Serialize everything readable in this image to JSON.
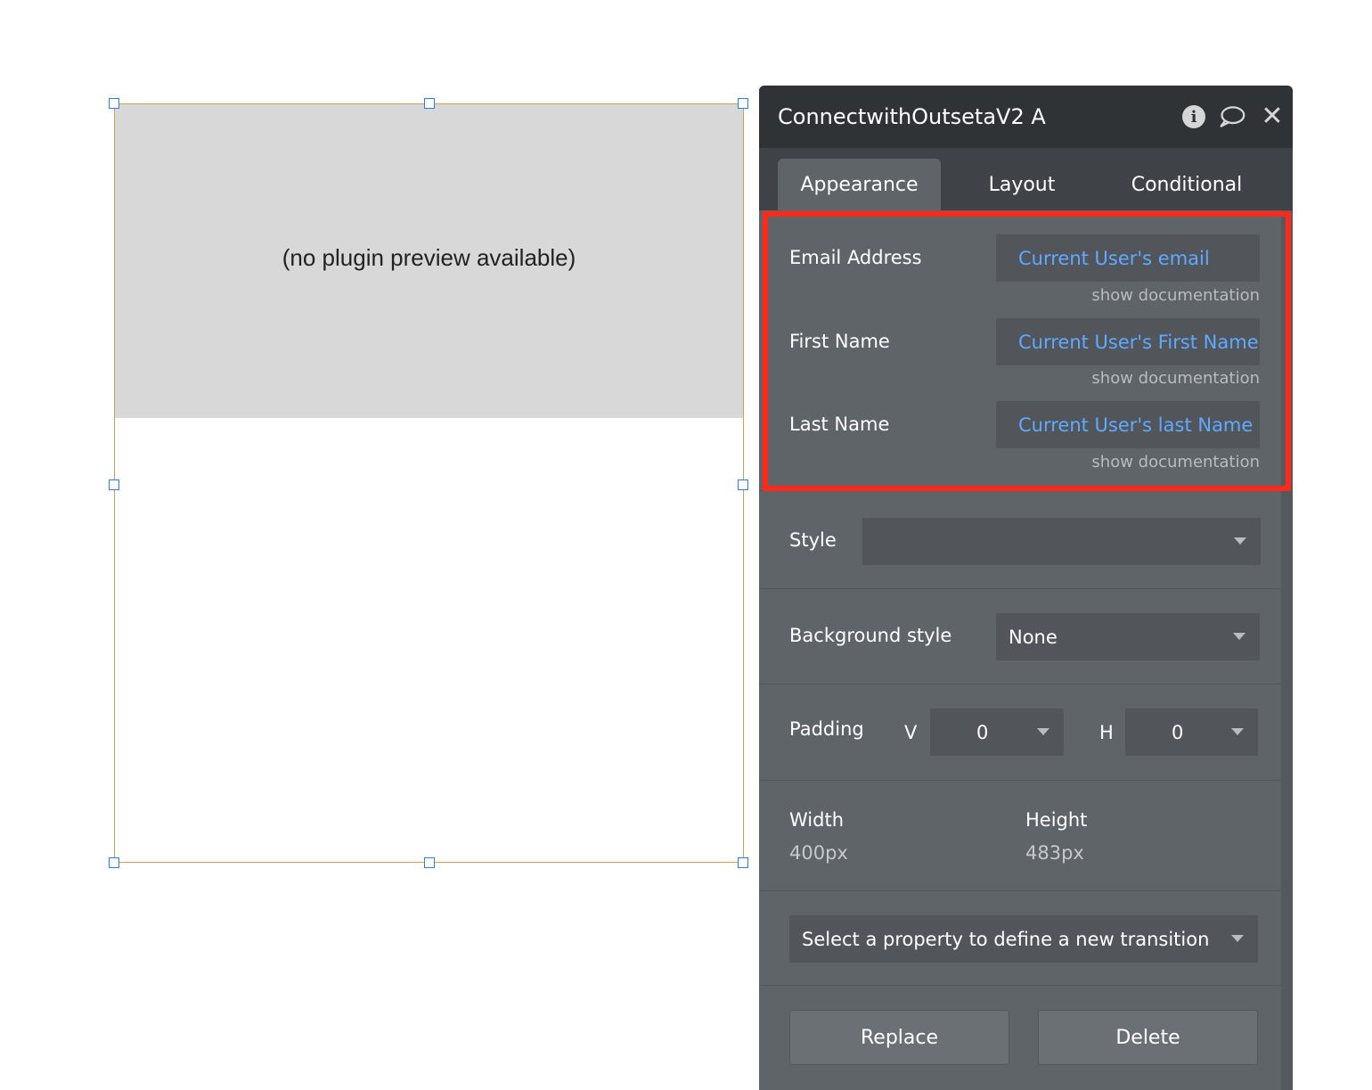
{
  "canvas": {
    "preview_text": "(no plugin preview available)"
  },
  "panel": {
    "title": "ConnectwithOutsetaV2 A",
    "header_icons": [
      "info-icon",
      "comment-icon",
      "close-icon"
    ],
    "tabs": [
      {
        "label": "Appearance",
        "active": true
      },
      {
        "label": "Layout",
        "active": false
      },
      {
        "label": "Conditional",
        "active": false
      }
    ],
    "fields": [
      {
        "label": "Email Address",
        "value": "Current User's email",
        "doc": "show documentation"
      },
      {
        "label": "First Name",
        "value": "Current User's First Name",
        "doc": "show documentation"
      },
      {
        "label": "Last Name",
        "value": "Current User's last Name",
        "doc": "show documentation"
      }
    ],
    "style": {
      "label": "Style",
      "value": ""
    },
    "background": {
      "label": "Background style",
      "value": "None"
    },
    "padding": {
      "label": "Padding",
      "v_label": "V",
      "v_value": "0",
      "h_label": "H",
      "h_value": "0"
    },
    "size": {
      "width_label": "Width",
      "width_value": "400px",
      "height_label": "Height",
      "height_value": "483px"
    },
    "transition": {
      "placeholder": "Select a property to define a new transition"
    },
    "buttons": {
      "replace": "Replace",
      "delete": "Delete"
    }
  },
  "colors": {
    "panel_bg": "#5f6469",
    "header_bg": "#2f3336",
    "dynamic_value": "#5fa9ff",
    "highlight": "#ff2a1a",
    "selection_handle": "#2d7be5"
  }
}
